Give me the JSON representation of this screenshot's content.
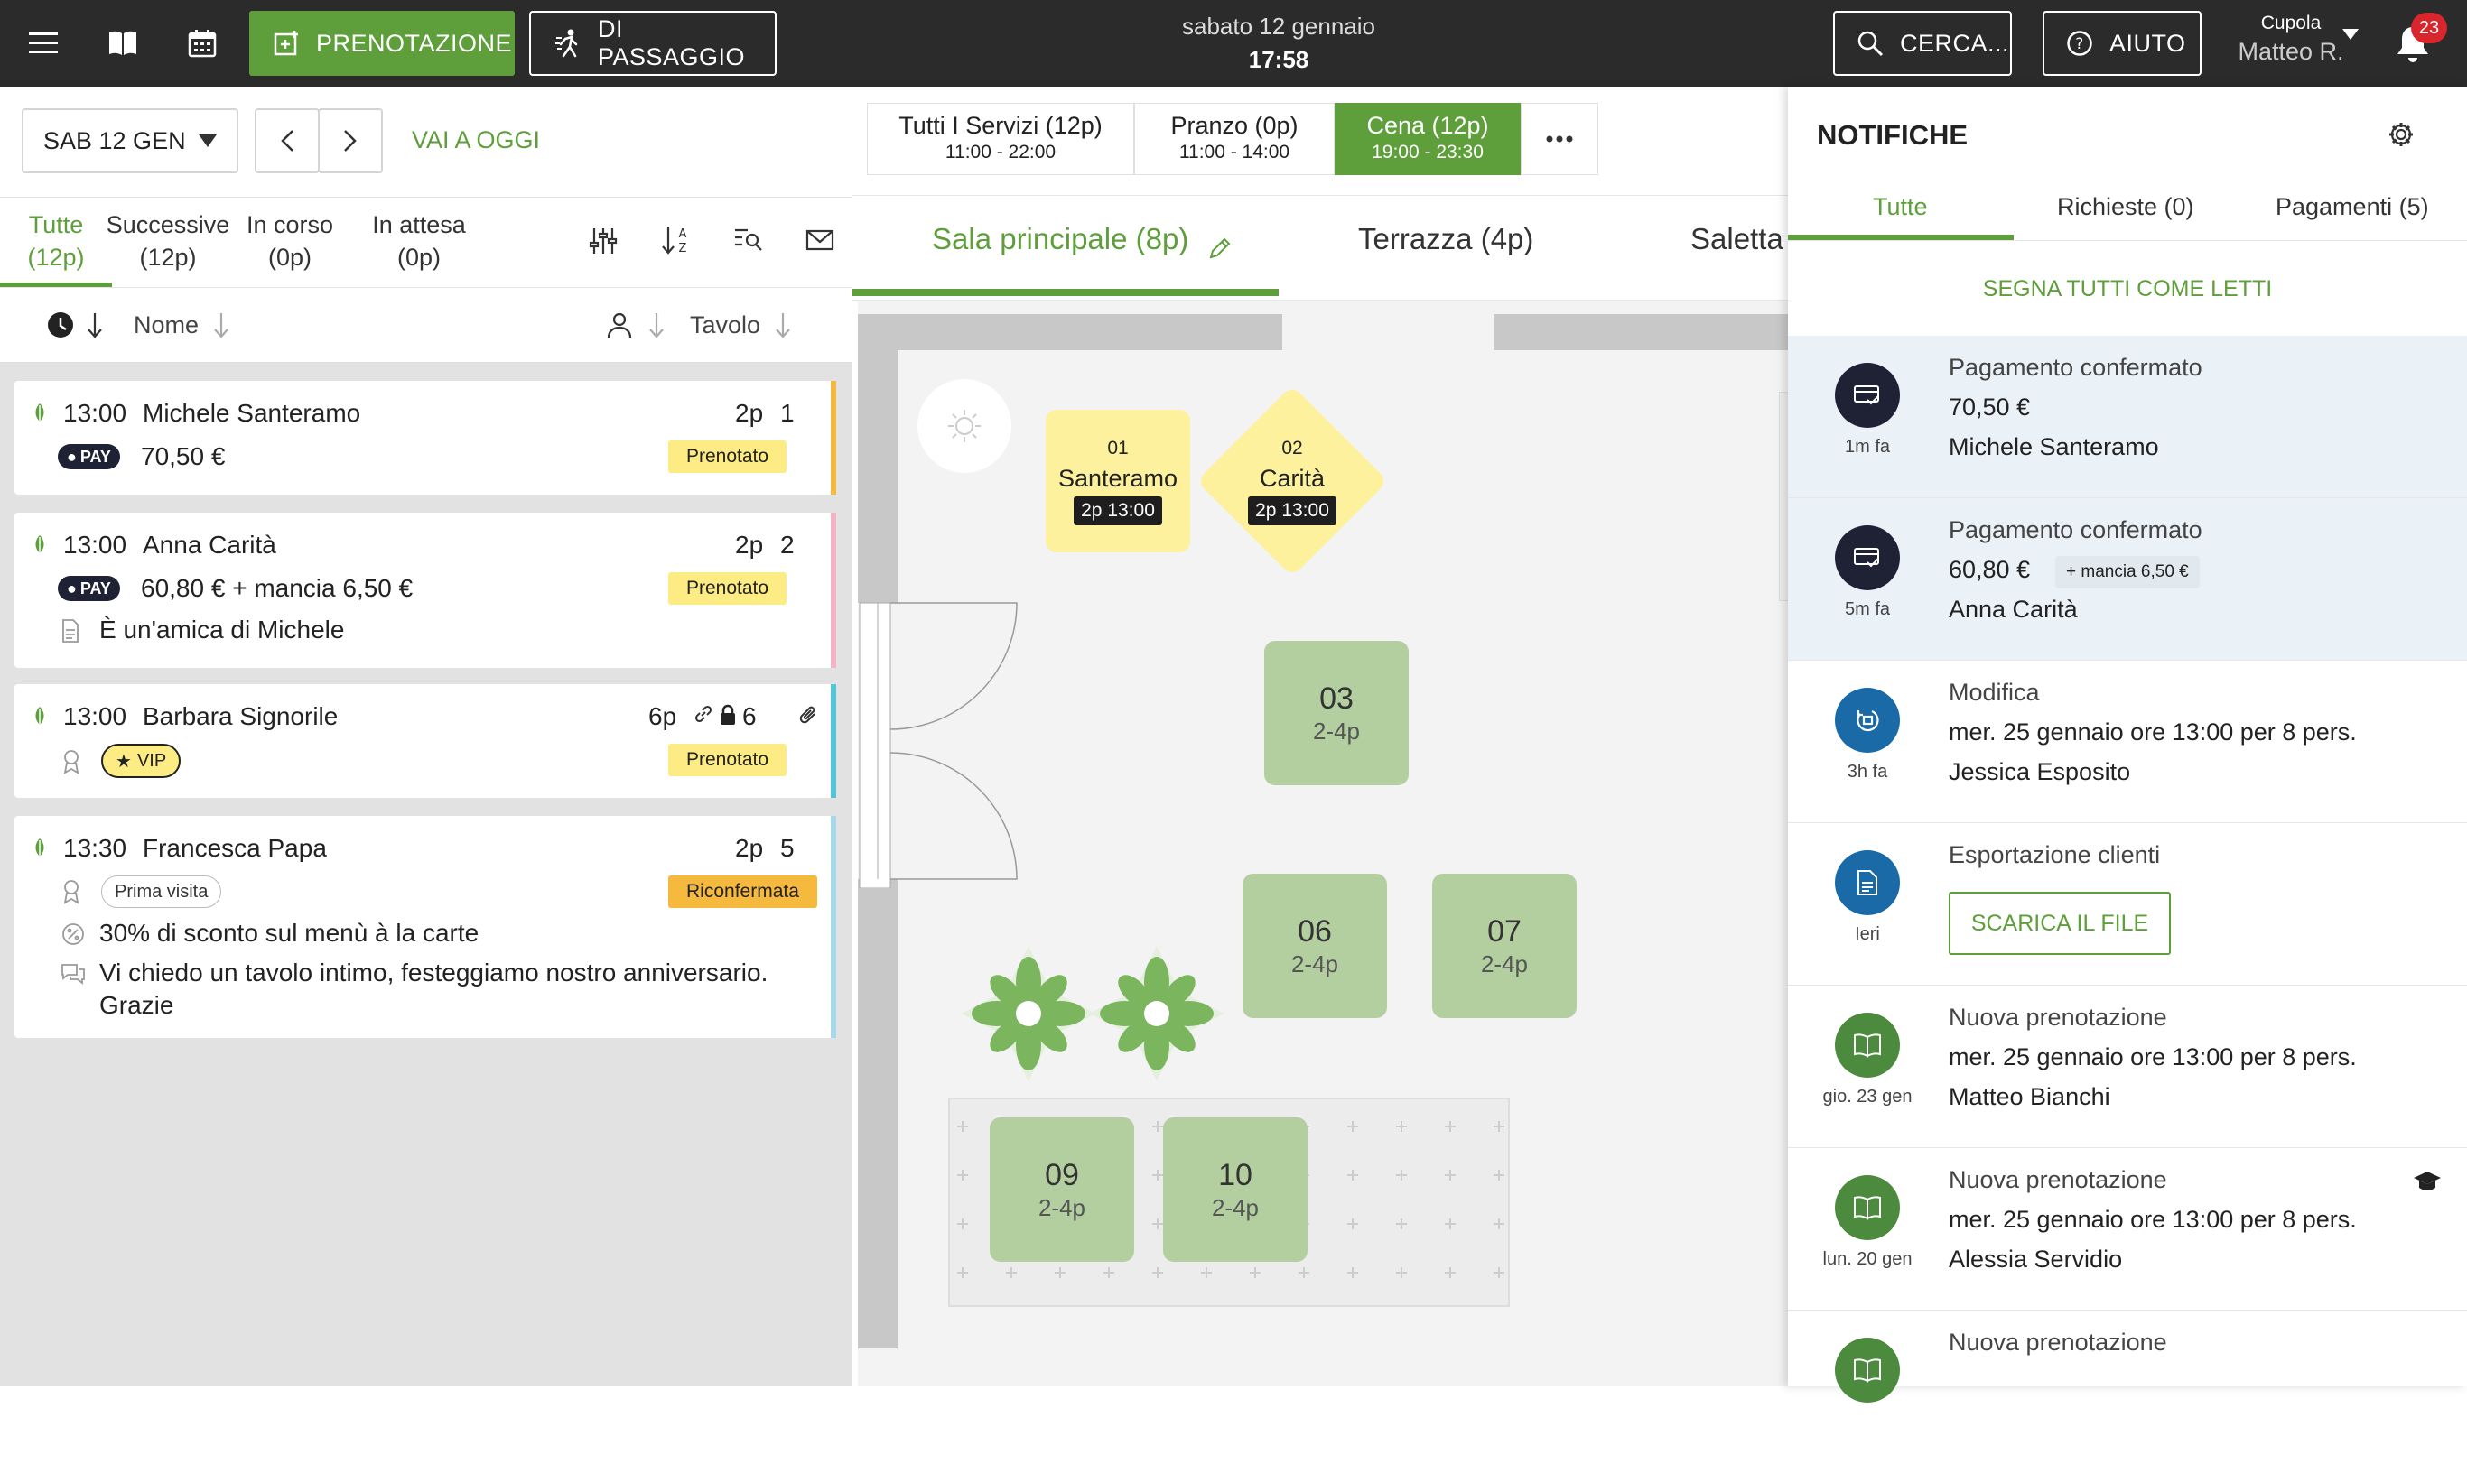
{
  "topbar": {
    "new_booking": "PRENOTAZIONE",
    "walk_in": "DI PASSAGGIO",
    "date": "sabato 12 gennaio",
    "time": "17:58",
    "search": "CERCA...",
    "help": "AIUTO",
    "venue": "Cupola",
    "user": "Matteo R.",
    "notif_count": "23"
  },
  "datebar": {
    "date_select": "SAB 12 GEN",
    "today": "VAI A OGGI"
  },
  "list_tabs": [
    {
      "label": "Tutte",
      "count": "(12p)"
    },
    {
      "label": "Successive",
      "count": "(12p)"
    },
    {
      "label": "In corso",
      "count": "(0p)"
    },
    {
      "label": "In attesa",
      "count": "(0p)"
    }
  ],
  "sort": {
    "name": "Nome",
    "table": "Tavolo"
  },
  "reservations": [
    {
      "time": "13:00",
      "name": "Michele Santeramo",
      "pax": "2p",
      "table": "1",
      "pay": "PAY",
      "amount": "70,50 €",
      "status": "Prenotato"
    },
    {
      "time": "13:00",
      "name": "Anna Carità",
      "pax": "2p",
      "table": "2",
      "pay": "PAY",
      "amount": "60,80 € + mancia 6,50 €",
      "status": "Prenotato",
      "note": "È un'amica di Michele"
    },
    {
      "time": "13:00",
      "name": "Barbara Signorile",
      "pax": "6p",
      "table": "6",
      "vip": "VIP",
      "status": "Prenotato"
    },
    {
      "time": "13:30",
      "name": "Francesca Papa",
      "pax": "2p",
      "table": "5",
      "tag": "Prima visita",
      "status": "Riconfermata",
      "discount": "30% di sconto sul menù à la carte",
      "note_line1": "Vi chiedo un tavolo intimo, festeggiamo nostro anniversario.",
      "note_line2": "Grazie"
    }
  ],
  "services": [
    {
      "label": "Tutti I Servizi (12p)",
      "hours": "11:00 - 22:00"
    },
    {
      "label": "Pranzo (0p)",
      "hours": "11:00 - 14:00"
    },
    {
      "label": "Cena (12p)",
      "hours": "19:00 - 23:30"
    }
  ],
  "rooms": [
    "Sala principale (8p)",
    "Terrazza (4p)",
    "Saletta"
  ],
  "tables": [
    {
      "num": "01",
      "name": "Santeramo",
      "chip": "2p 13:00"
    },
    {
      "num": "02",
      "name": "Carità",
      "chip": "2p 13:00"
    },
    {
      "num": "03",
      "cap": "2-4p"
    },
    {
      "num": "06",
      "cap": "2-4p"
    },
    {
      "num": "07",
      "cap": "2-4p"
    },
    {
      "num": "09",
      "cap": "2-4p"
    },
    {
      "num": "10",
      "cap": "2-4p"
    }
  ],
  "notifications": {
    "title": "NOTIFICHE",
    "tabs": [
      "Tutte",
      "Richieste (0)",
      "Pagamenti (5)"
    ],
    "mark_all": "SEGNA TUTTI COME LETTI",
    "items": [
      {
        "ago": "1m fa",
        "title": "Pagamento confermato",
        "line2": "70,50 €",
        "line3": "Michele Santeramo"
      },
      {
        "ago": "5m fa",
        "title": "Pagamento confermato",
        "line2": "60,80 €",
        "tip": "+ mancia 6,50 €",
        "line3": "Anna Carità"
      },
      {
        "ago": "3h fa",
        "title": "Modifica",
        "line2": "mer. 25 gennaio ore 13:00 per 8 pers.",
        "line3": "Jessica Esposito"
      },
      {
        "ago": "Ieri",
        "title": "Esportazione clienti",
        "button": "SCARICA IL FILE"
      },
      {
        "ago": "gio. 23 gen",
        "title": "Nuova prenotazione",
        "line2": "mer. 25 gennaio ore 13:00 per 8 pers.",
        "line3": "Matteo Bianchi"
      },
      {
        "ago": "lun. 20 gen",
        "title": "Nuova prenotazione",
        "line2": "mer. 25 gennaio ore 13:00 per 8 pers.",
        "line3": "Alessia Servidio"
      },
      {
        "title": "Nuova prenotazione"
      }
    ]
  },
  "colors": {
    "green": "#5e9e3b",
    "dark": "#2b2b2b",
    "navy": "#1f2235",
    "blue": "#1a6aa8",
    "darkgreen": "#4c8a3e",
    "prenotato": "#fdeb83",
    "riconfermata": "#f5b93e"
  }
}
